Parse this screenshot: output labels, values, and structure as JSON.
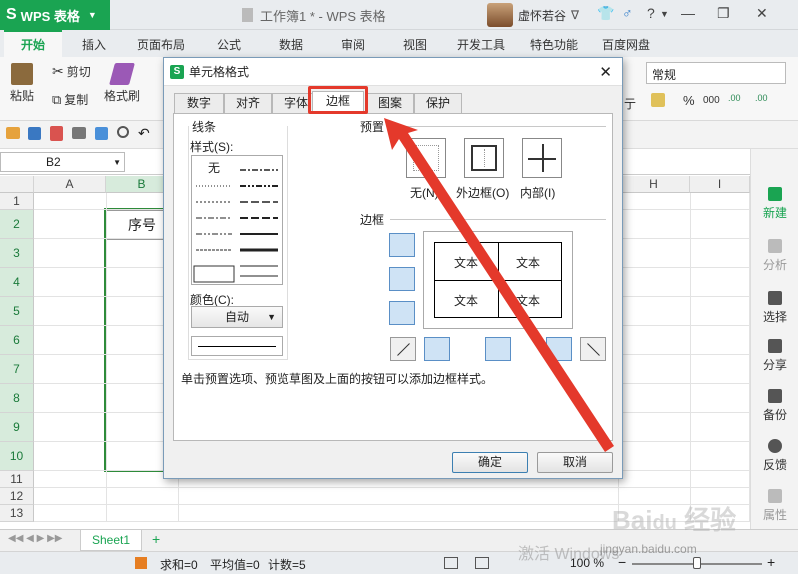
{
  "titlebar": {
    "app_name": "WPS 表格",
    "doc_title": "工作簿1 * - WPS 表格",
    "user_name": "虚怀若谷",
    "help": "?"
  },
  "ribbon_tabs": [
    "开始",
    "插入",
    "页面布局",
    "公式",
    "数据",
    "审阅",
    "视图",
    "开发工具",
    "特色功能",
    "百度网盘"
  ],
  "ribbon": {
    "paste": "粘贴",
    "cut": "剪切",
    "copy": "复制",
    "format_painter": "格式刷",
    "number_format": "常规",
    "percent": "%",
    "comma": "000",
    "partial_label": "亍"
  },
  "formula_bar": {
    "name_box": "B2"
  },
  "grid": {
    "columns": [
      "A",
      "B",
      "H",
      "I"
    ],
    "rows": [
      "1",
      "2",
      "3",
      "4",
      "5",
      "6",
      "7",
      "8",
      "9",
      "10",
      "11",
      "12",
      "13"
    ],
    "b2_value": "序号"
  },
  "right_panel": [
    "新建",
    "分析",
    "选择",
    "分享",
    "备份",
    "反馈",
    "属性"
  ],
  "sheet": {
    "tab": "Sheet1"
  },
  "status": {
    "sum": "求和=0",
    "avg": "平均值=0",
    "count": "计数=5",
    "zoom": "100 %"
  },
  "watermark": {
    "text": "激活 Windows",
    "site": "jingyan.baidu.com"
  },
  "dialog": {
    "title": "单元格格式",
    "tabs": [
      "数字",
      "对齐",
      "字体",
      "边框",
      "图案",
      "保护"
    ],
    "line_group": "线条",
    "style_label": "样式(S):",
    "style_none": "无",
    "color_label": "颜色(C):",
    "color_value": "自动",
    "preset_group": "预置",
    "preset_none": "无(N)",
    "preset_outline": "外边框(O)",
    "preset_inside": "内部(I)",
    "border_group": "边框",
    "preview_text": [
      "文本",
      "文本",
      "文本",
      "文本"
    ],
    "hint": "单击预置选项、预览草图及上面的按钮可以添加边框样式。",
    "ok": "确定",
    "cancel": "取消"
  },
  "colors": {
    "accent": "#1aa452",
    "highlight": "#e4392b"
  }
}
